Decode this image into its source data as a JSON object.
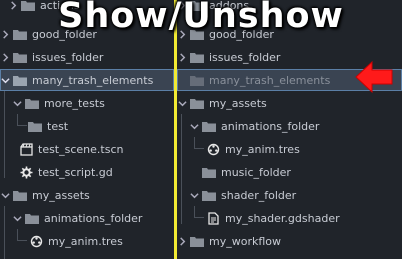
{
  "overlay": {
    "title": "Show/Unshow"
  },
  "colors": {
    "divider": "#f1ea33",
    "pointer": "#ff1a1a",
    "selected": "#3a4452",
    "folder": "#8a9099"
  },
  "left_tree": {
    "top_partial_label": "actions",
    "items": [
      {
        "label": "good_folder"
      },
      {
        "label": "issues_folder"
      },
      {
        "label": "many_trash_elements"
      },
      {
        "label": "more_tests"
      },
      {
        "label": "test"
      },
      {
        "label": "test_scene.tscn"
      },
      {
        "label": "test_script.gd"
      },
      {
        "label": "my_assets"
      },
      {
        "label": "animations_folder"
      },
      {
        "label": "my_anim.tres"
      }
    ]
  },
  "right_tree": {
    "top_partial_label": "addons",
    "items": [
      {
        "label": "good_folder"
      },
      {
        "label": "issues_folder"
      },
      {
        "label": "many_trash_elements"
      },
      {
        "label": "my_assets"
      },
      {
        "label": "animations_folder"
      },
      {
        "label": "my_anim.tres"
      },
      {
        "label": "music_folder"
      },
      {
        "label": "shader_folder"
      },
      {
        "label": "my_shader.gdshader"
      },
      {
        "label": "my_workflow"
      }
    ]
  },
  "icons": {
    "folder": "folder-icon",
    "scene": "scene-icon",
    "script": "gear-icon",
    "animation": "animation-icon",
    "shader": "shader-icon",
    "expanded": "chevron-down-icon",
    "collapsed": "chevron-right-icon"
  }
}
